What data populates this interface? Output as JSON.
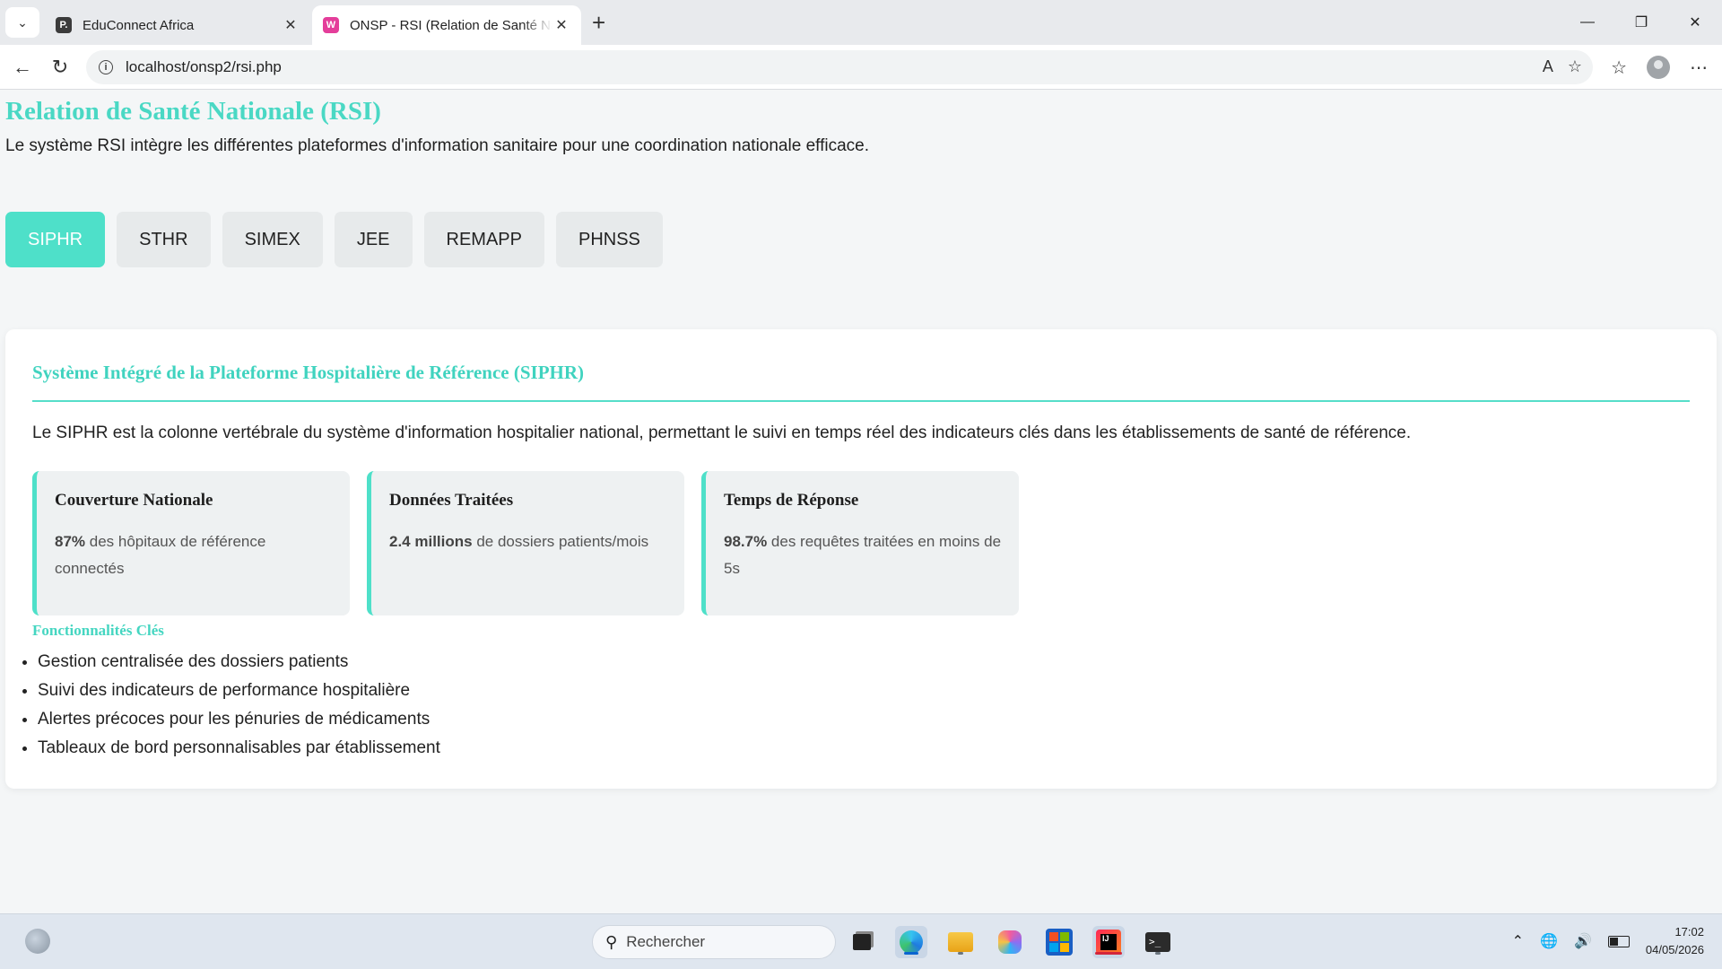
{
  "browser": {
    "tabs": [
      {
        "title": "EduConnect Africa",
        "favicon": "P.",
        "favicon_color": "#3b3b3b"
      },
      {
        "title": "ONSP - RSI (Relation de Santé Nat",
        "favicon": "W",
        "favicon_color": "#e43e9a"
      }
    ],
    "url": "localhost/onsp2/rsi.php"
  },
  "page": {
    "title": "Relation de Santé Nationale (RSI)",
    "subtitle": "Le système RSI intègre les différentes plateformes d'information sanitaire pour une coordination nationale efficace.",
    "tabs": [
      "SIPHR",
      "STHR",
      "SIMEX",
      "JEE",
      "REMAPP",
      "PHNSS"
    ],
    "active_tab": "SIPHR",
    "accent_color": "#4ee0c9"
  },
  "card": {
    "title": "Système Intégré de la Plateforme Hospitalière de Référence (SIPHR)",
    "description": "Le SIPHR est la colonne vertébrale du système d'information hospitalier national, permettant le suivi en temps réel des indicateurs clés dans les établissements de santé de référence.",
    "stats": [
      {
        "title": "Couverture Nationale",
        "value": "87%",
        "text": " des hôpitaux de référence connectés"
      },
      {
        "title": "Données Traitées",
        "value": "2.4 millions",
        "text": " de dossiers patients/mois"
      },
      {
        "title": "Temps de Réponse",
        "value": "98.7%",
        "text": " des requêtes traitées en moins de 5s"
      }
    ],
    "features_title": "Fonctionnalités Clés",
    "features": [
      "Gestion centralisée des dossiers patients",
      "Suivi des indicateurs de performance hospitalière",
      "Alertes précoces pour les pénuries de médicaments",
      "Tableaux de bord personnalisables par établissement"
    ]
  },
  "taskbar": {
    "search_placeholder": "Rechercher",
    "time": "17:02",
    "date": "04/05/2026"
  }
}
